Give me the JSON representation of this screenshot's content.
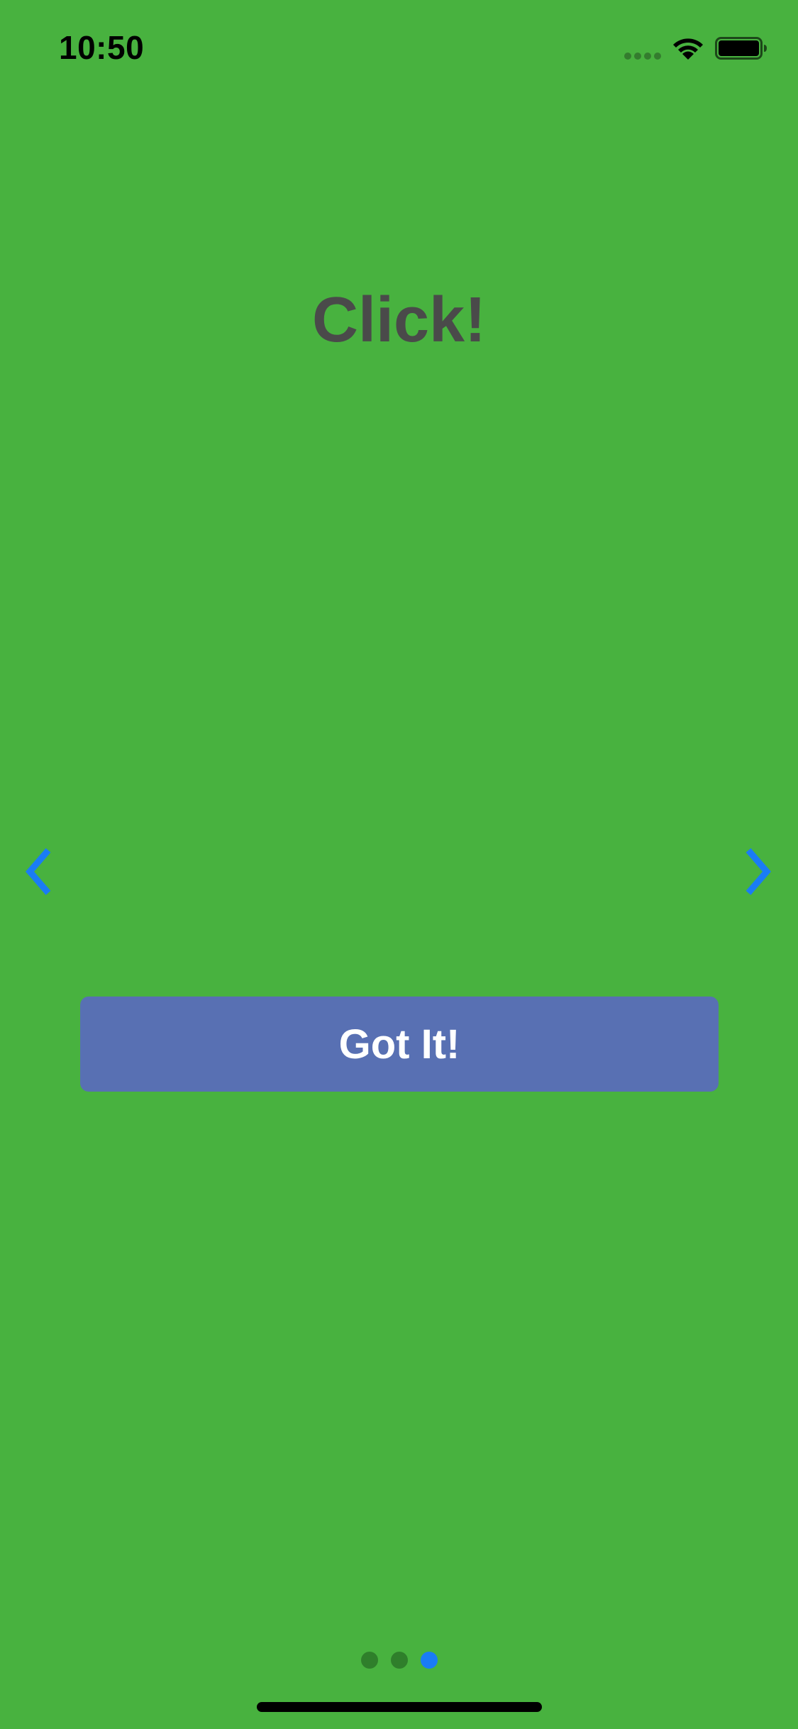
{
  "status_bar": {
    "time": "10:50",
    "icons": [
      "signal-icon",
      "wifi-icon",
      "battery-icon"
    ]
  },
  "onboarding": {
    "title": "Click!",
    "prev_icon": "chevron-left-icon",
    "next_icon": "chevron-right-icon",
    "button_label": "Got It!",
    "page_count": 3,
    "current_page": 3
  },
  "colors": {
    "background": "#48b23f",
    "title_text": "#4a4a4a",
    "button_background": "#5870b3",
    "button_text": "#ffffff",
    "accent": "#1a7cf5",
    "inactive_dot": "#2f7f2b"
  }
}
